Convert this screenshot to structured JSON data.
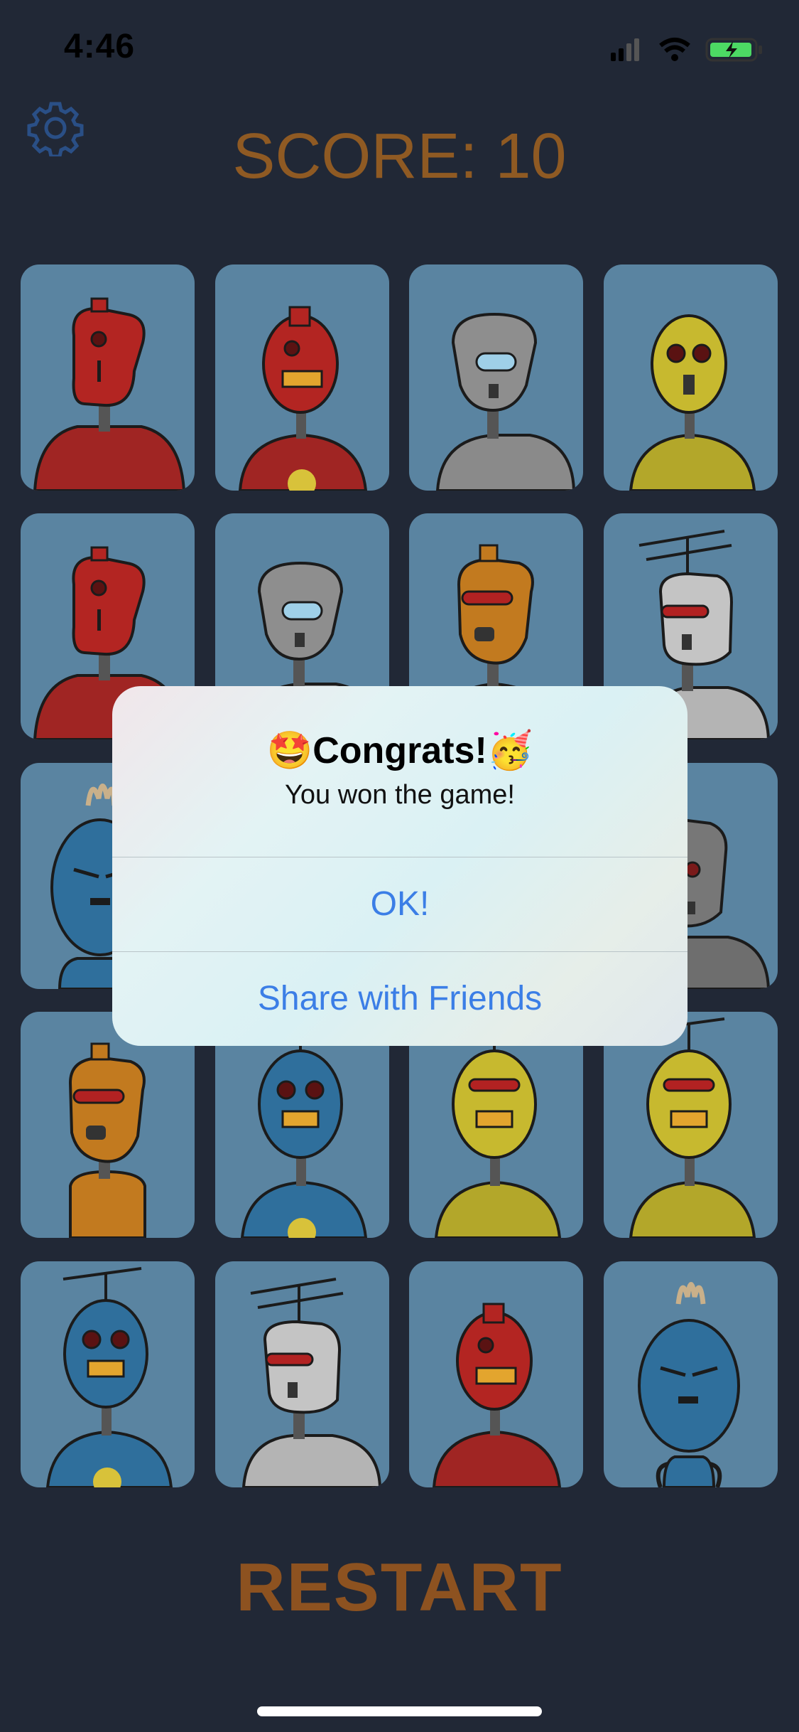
{
  "status_bar": {
    "time": "4:46"
  },
  "header": {
    "score_text": "SCORE: 10"
  },
  "grid": {
    "cards": [
      {
        "robot": "red-slim"
      },
      {
        "robot": "red-round"
      },
      {
        "robot": "gray-visor"
      },
      {
        "robot": "yellow-round"
      },
      {
        "robot": "red-slim"
      },
      {
        "robot": "gray-visor"
      },
      {
        "robot": "orange-slim"
      },
      {
        "robot": "silver-antenna"
      },
      {
        "robot": "blue-tuft"
      },
      {
        "robot": "hidden"
      },
      {
        "robot": "hidden"
      },
      {
        "robot": "gray-eye"
      },
      {
        "robot": "orange-slim"
      },
      {
        "robot": "blue-antenna"
      },
      {
        "robot": "yellow-antenna"
      },
      {
        "robot": "yellow-antenna"
      },
      {
        "robot": "blue-antenna"
      },
      {
        "robot": "silver-antenna"
      },
      {
        "robot": "red-round"
      },
      {
        "robot": "blue-tuft"
      }
    ]
  },
  "alert": {
    "emoji_left": "🤩",
    "title": "Congrats!",
    "emoji_right": "🥳",
    "message": "You won the game!",
    "ok_label": "OK!",
    "share_label": "Share with Friends"
  },
  "footer": {
    "restart_label": "RESTART"
  },
  "colors": {
    "background": "#212836",
    "card": "#5a84a1",
    "score": "#8f5a23",
    "restart": "#8d5220",
    "alert_button": "#3b7ee6"
  }
}
